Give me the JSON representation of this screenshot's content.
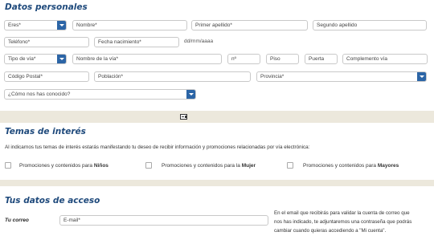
{
  "personal": {
    "title": "Datos personales",
    "eres": "Eres*",
    "nombre": "Nombre*",
    "primer_apellido": "Primer apellido*",
    "segundo_apellido": "Segundo apellido",
    "telefono": "Teléfono*",
    "fecha_nacimiento": "Fecha nacimiento*",
    "fecha_formato": "dd/mm/aaaa",
    "tipo_via": "Tipo de vía*",
    "nombre_via": "Nombre de la vía*",
    "numero": "nº",
    "piso": "Piso",
    "puerta": "Puerta",
    "complemento": "Complemento vía",
    "codigo_postal": "Código Postal*",
    "poblacion": "Población*",
    "provincia": "Provincia*",
    "como_conocido": "¿Cómo nos has conocido?"
  },
  "interest": {
    "title": "Temas de interés",
    "description": "Al indicarnos tus temas de interés estarás manifestando tu deseo de recibir información y promociones relacionadas por vía electrónica:",
    "options": [
      {
        "prefix": "Promociones y contenidos para ",
        "bold": "Niños"
      },
      {
        "prefix": "Promociones y contenidos para la ",
        "bold": "Mujer"
      },
      {
        "prefix": "Promociones y contenidos para ",
        "bold": "Mayores"
      }
    ]
  },
  "access": {
    "title": "Tus datos de acceso",
    "email_label": "Tu correo",
    "email_placeholder": "E-mail*",
    "note_line1": "En el email que recibirás para validar la cuenta de correo que",
    "note_line2": "nos has indicado, te adjuntaremos una contraseña que podrás",
    "note_line3": "cambiar cuando quieras accediendo a \"Mi cuenta\"."
  },
  "colors": {
    "title": "#1f4a7c",
    "select_button": "#2c65a6",
    "band": "#ece8dc"
  }
}
